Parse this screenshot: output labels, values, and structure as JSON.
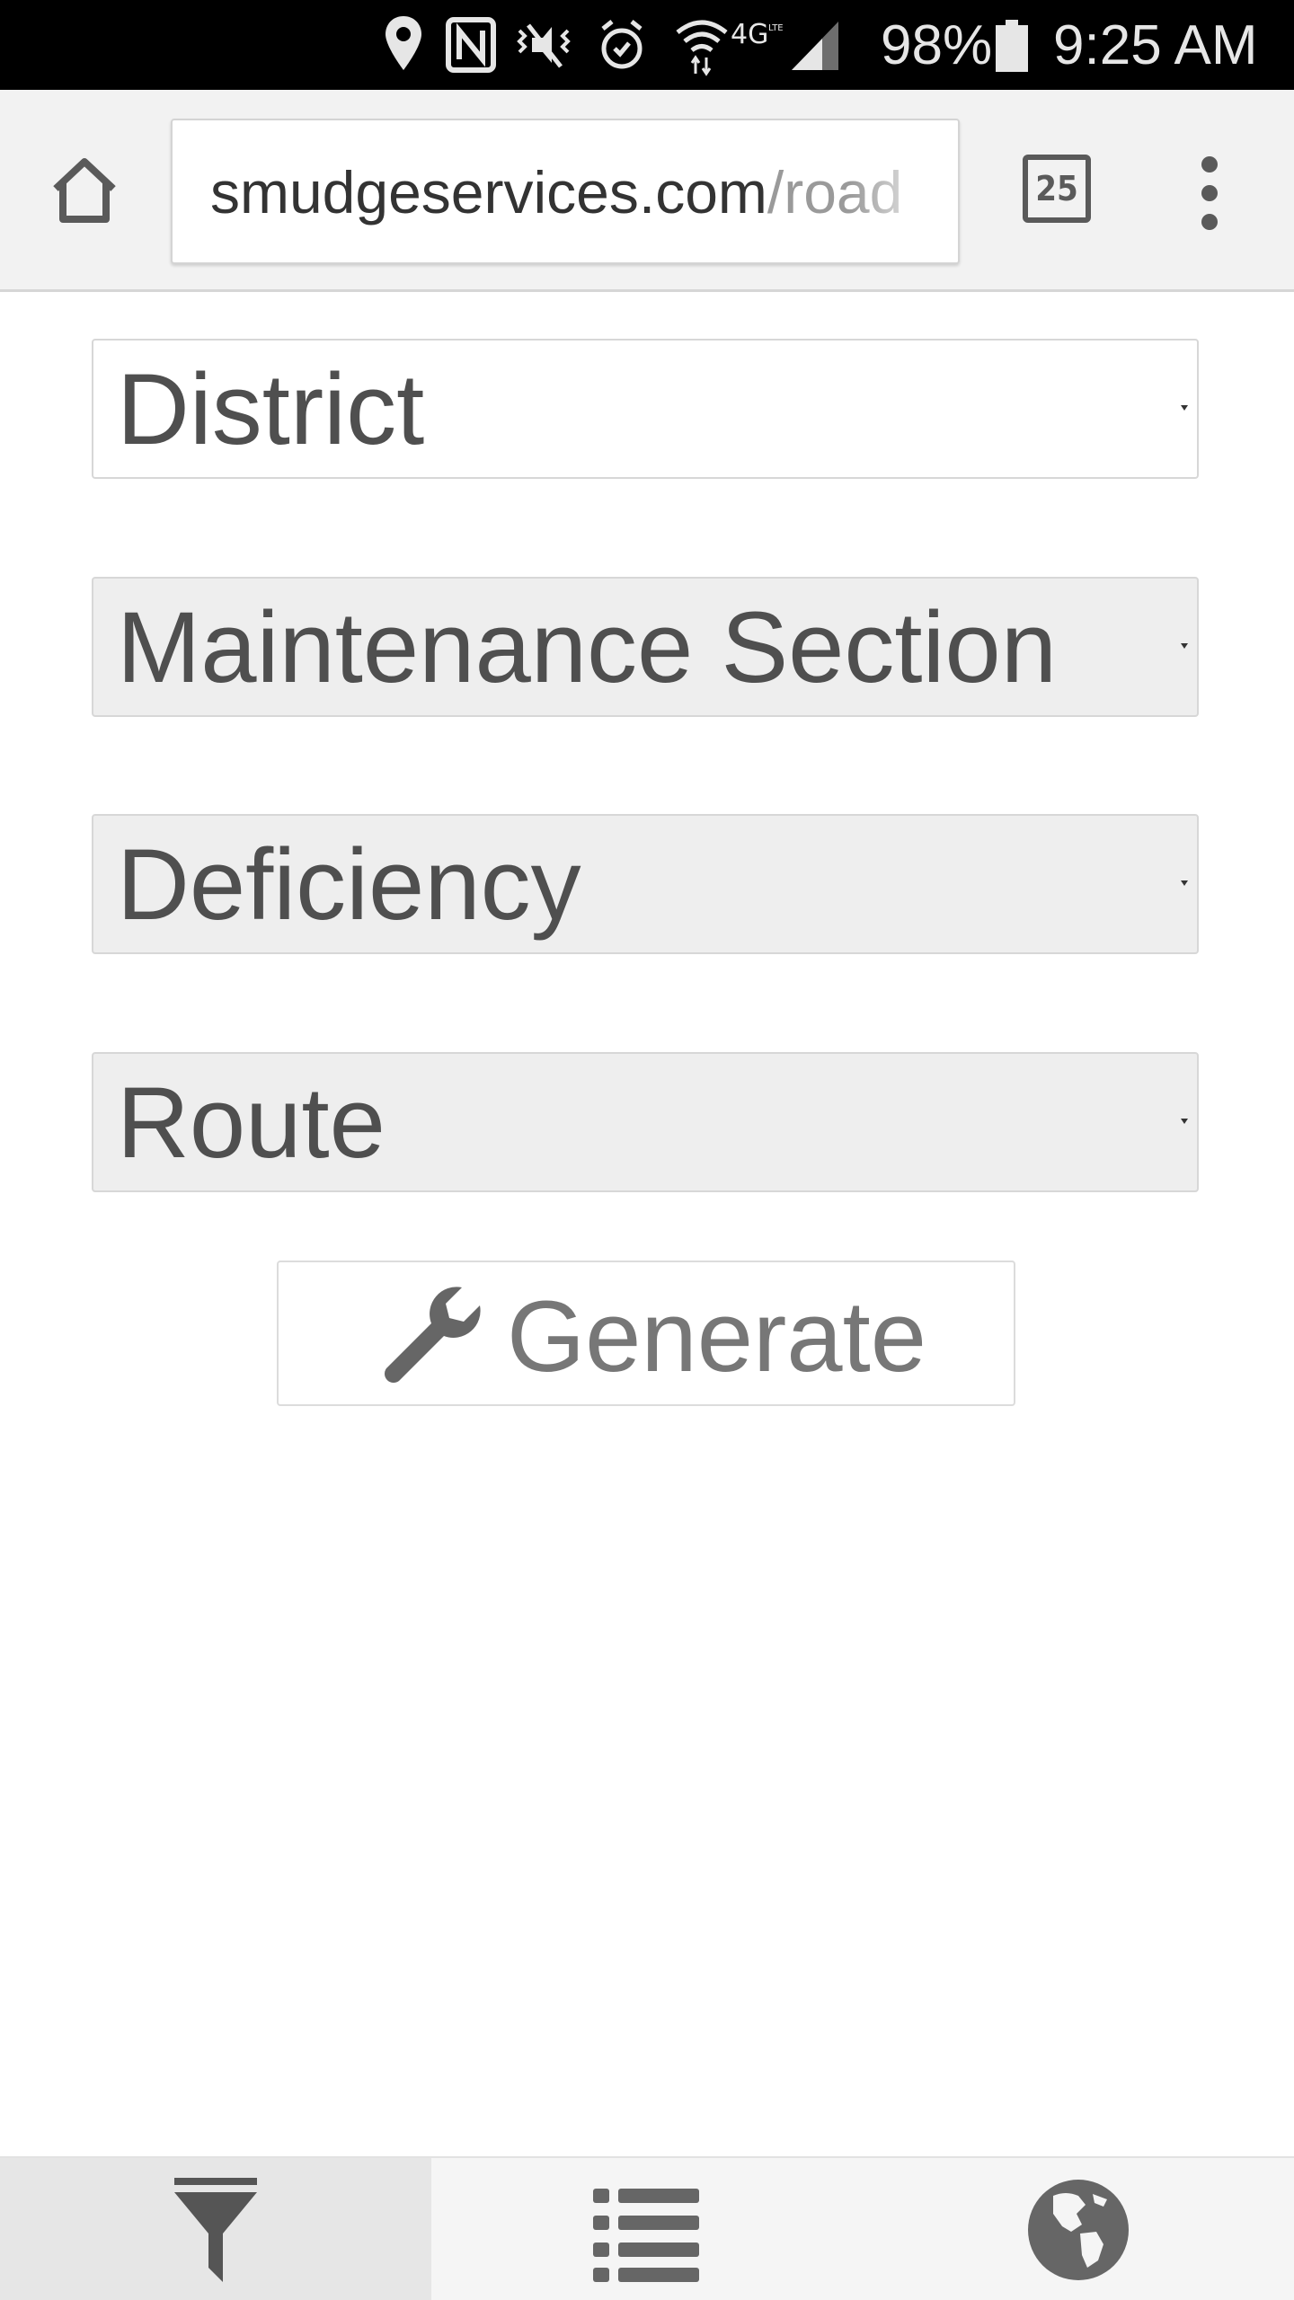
{
  "status_bar": {
    "battery_percent": "98%",
    "time": "9:25 AM",
    "icons": [
      "location-icon",
      "nfc-icon",
      "vibrate-icon",
      "alarm-icon",
      "wifi-icon",
      "4g-lte-icon",
      "signal-icon",
      "battery-icon"
    ]
  },
  "browser": {
    "url_host": "smudgeservices.com",
    "url_path": "/road",
    "tab_count": "25"
  },
  "form": {
    "selects": [
      {
        "label": "District"
      },
      {
        "label": "Maintenance Section"
      },
      {
        "label": "Deficiency"
      },
      {
        "label": "Route"
      }
    ],
    "generate_label": "Generate"
  },
  "bottom_nav": {
    "items": [
      "filter-icon",
      "list-icon",
      "globe-icon"
    ],
    "active": "filter-icon"
  },
  "colors": {
    "status_bar_bg": "#000000",
    "toolbar_bg": "#f2f2f2",
    "select_disabled_bg": "#eeeeee",
    "text": "#4f4f4f"
  }
}
